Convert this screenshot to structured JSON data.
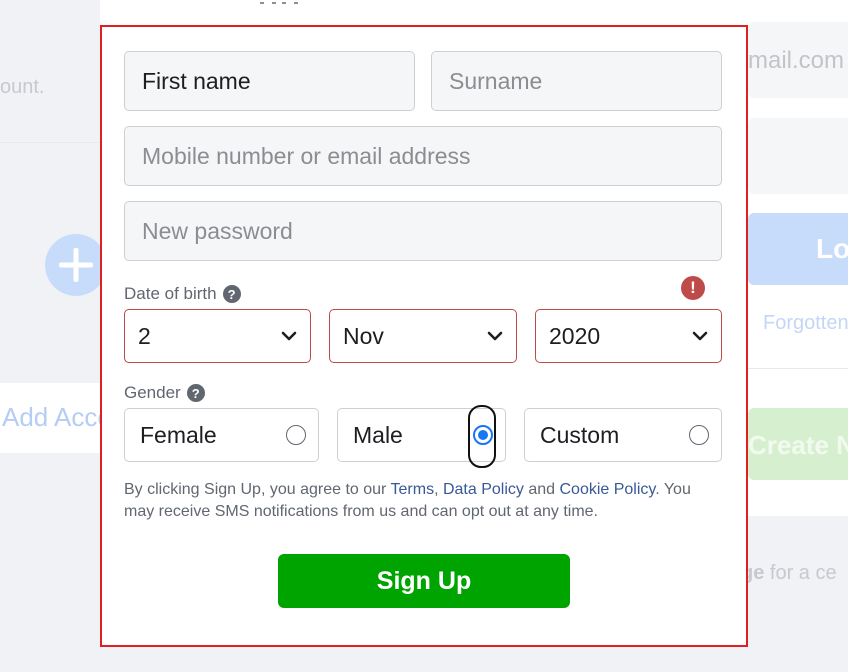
{
  "background": {
    "left_text": "count.",
    "add_account_label": "Add Acco",
    "email_text": "mail.com",
    "login_label": "Lo",
    "forgotten_text": "Forgotten",
    "create_label": "Create Ne",
    "page_note_bold": "ge",
    "page_note_rest": " for a ce"
  },
  "form": {
    "first_name": {
      "value": "First name"
    },
    "surname": {
      "placeholder": "Surname"
    },
    "mobile_email": {
      "placeholder": "Mobile number or email address"
    },
    "new_password": {
      "placeholder": "New password"
    },
    "dob": {
      "label": "Date of birth",
      "help_icon": "?",
      "error_icon": "!",
      "day": "2",
      "month": "Nov",
      "year": "2020"
    },
    "gender": {
      "label": "Gender",
      "help_icon": "?",
      "options": [
        {
          "label": "Female",
          "checked": false
        },
        {
          "label": "Male",
          "checked": true
        },
        {
          "label": "Custom",
          "checked": false
        }
      ]
    },
    "terms": {
      "prefix": "By clicking Sign Up, you agree to our ",
      "terms_link": "Terms",
      "sep1": ", ",
      "data_policy_link": "Data Policy",
      "and": " and ",
      "cookie_policy_link": "Cookie Policy",
      "suffix": ". You may receive SMS notifications from us and can opt out at any time."
    },
    "signup_label": "Sign Up"
  },
  "colors": {
    "signup_green": "#00a400",
    "error_red": "#be4b49",
    "link_blue": "#385898",
    "radio_blue": "#1877f2",
    "highlight_border": "#e02020"
  }
}
